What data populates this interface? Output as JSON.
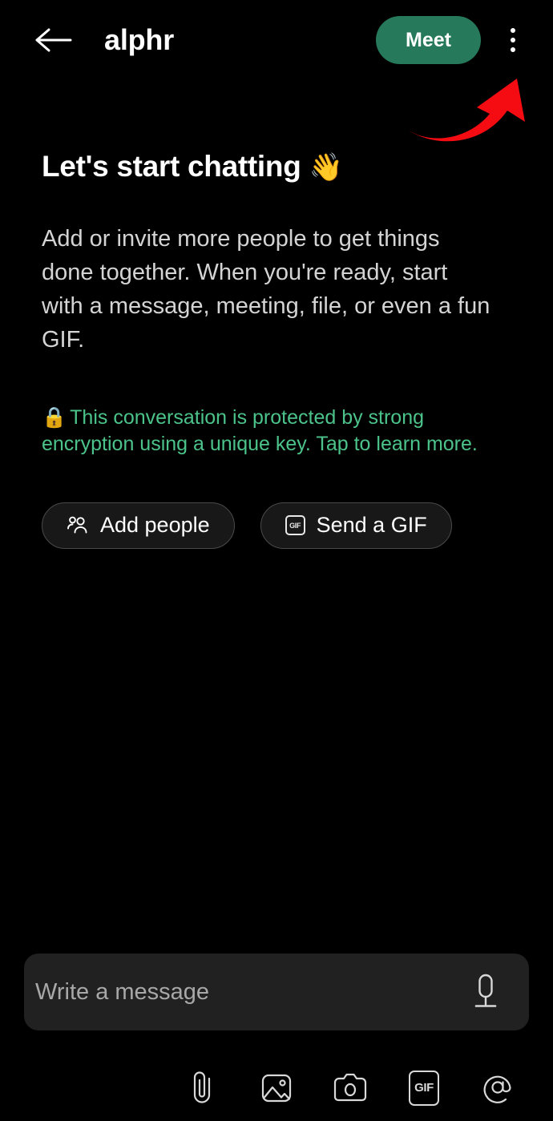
{
  "app": {
    "background_color": "#000000"
  },
  "appbar": {
    "back_icon": "arrow-left-icon",
    "title": "alphr",
    "meet_label": "Meet",
    "meet_color": "#26795a",
    "overflow_icon": "more-vertical-icon"
  },
  "annotation": {
    "type": "curved-arrow",
    "color": "#f40c12",
    "points_to": "overflow-menu-button"
  },
  "welcome": {
    "heading": "Let's start chatting",
    "heading_emoji": "👋",
    "body": "Add or invite more people to get things done together. When you're ready, start with a message, meeting, file, or even a fun GIF.",
    "encryption_emoji": "🔒",
    "encryption_text": "This conversation is protected by strong encryption using a unique key. Tap to learn more.",
    "encryption_color": "#4cc38a"
  },
  "actions": [
    {
      "id": "add-people",
      "label": "Add people",
      "icon": "people-icon"
    },
    {
      "id": "send-gif",
      "label": "Send a GIF",
      "icon": "gif-icon",
      "icon_text": "GIF"
    }
  ],
  "composer": {
    "placeholder": "Write a message",
    "value": "",
    "mic_icon": "microphone-icon"
  },
  "toolbar": [
    {
      "id": "attach",
      "icon": "paperclip-icon",
      "label": ""
    },
    {
      "id": "gallery",
      "icon": "image-icon",
      "label": ""
    },
    {
      "id": "camera",
      "icon": "camera-icon",
      "label": ""
    },
    {
      "id": "gif",
      "icon": "gif-icon",
      "label": "GIF"
    },
    {
      "id": "mention",
      "icon": "at-sign-icon",
      "label": ""
    }
  ]
}
